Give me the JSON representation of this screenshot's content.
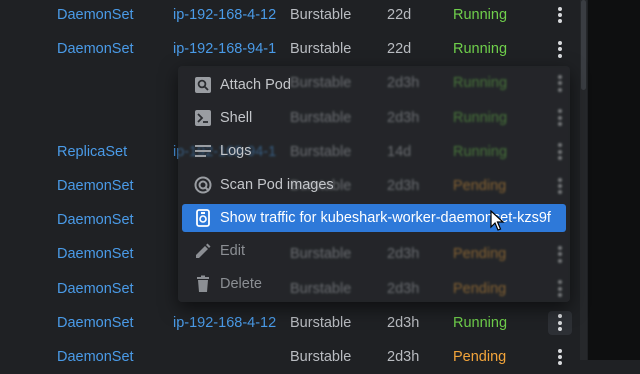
{
  "table": {
    "rows": [
      {
        "kind": "DaemonSet",
        "node": "ip-192-168-4-12",
        "qos": "Burstable",
        "age": "22d",
        "status": "Running",
        "status_type": "running"
      },
      {
        "kind": "DaemonSet",
        "node": "ip-192-168-94-1",
        "qos": "Burstable",
        "age": "22d",
        "status": "Running",
        "status_type": "running"
      },
      {
        "kind": "",
        "node": "",
        "qos": "Burstable",
        "age": "2d3h",
        "status": "Running",
        "status_type": "running"
      },
      {
        "kind": "",
        "node": "",
        "qos": "Burstable",
        "age": "2d3h",
        "status": "Running",
        "status_type": "running"
      },
      {
        "kind": "ReplicaSet",
        "node": "ip-192-168-94-1",
        "qos": "Burstable",
        "age": "14d",
        "status": "Running",
        "status_type": "running"
      },
      {
        "kind": "DaemonSet",
        "node": "",
        "qos": "Burstable",
        "age": "2d3h",
        "status": "Pending",
        "status_type": "pending"
      },
      {
        "kind": "DaemonSet",
        "node": "",
        "qos": "Burstable",
        "age": "2d3h",
        "status": "Pending",
        "status_type": "pending"
      },
      {
        "kind": "DaemonSet",
        "node": "",
        "qos": "Burstable",
        "age": "2d3h",
        "status": "Pending",
        "status_type": "pending"
      },
      {
        "kind": "DaemonSet",
        "node": "",
        "qos": "Burstable",
        "age": "2d3h",
        "status": "Pending",
        "status_type": "pending"
      },
      {
        "kind": "DaemonSet",
        "node": "ip-192-168-4-12",
        "qos": "Burstable",
        "age": "2d3h",
        "status": "Running",
        "status_type": "running"
      },
      {
        "kind": "DaemonSet",
        "node": "",
        "qos": "Burstable",
        "age": "2d3h",
        "status": "Pending",
        "status_type": "pending"
      }
    ]
  },
  "context_menu": {
    "items": [
      {
        "label": "Attach Pod",
        "icon": "attach-pod-icon",
        "state": "normal"
      },
      {
        "label": "Shell",
        "icon": "terminal-icon",
        "state": "normal"
      },
      {
        "label": "Logs",
        "icon": "logs-icon",
        "state": "normal"
      },
      {
        "label": "Scan Pod images",
        "icon": "scan-icon",
        "state": "normal"
      },
      {
        "label": "Show traffic for kubeshark-worker-daemonset-kzs9f",
        "icon": "traffic-icon",
        "state": "highlight"
      },
      {
        "label": "Edit",
        "icon": "edit-icon",
        "state": "disabled"
      },
      {
        "label": "Delete",
        "icon": "delete-icon",
        "state": "disabled"
      }
    ]
  },
  "colors": {
    "background": "#1f2124",
    "link": "#4a9be8",
    "running": "#6fcf4b",
    "pending": "#f2a43a",
    "highlight": "#2e79d9"
  }
}
